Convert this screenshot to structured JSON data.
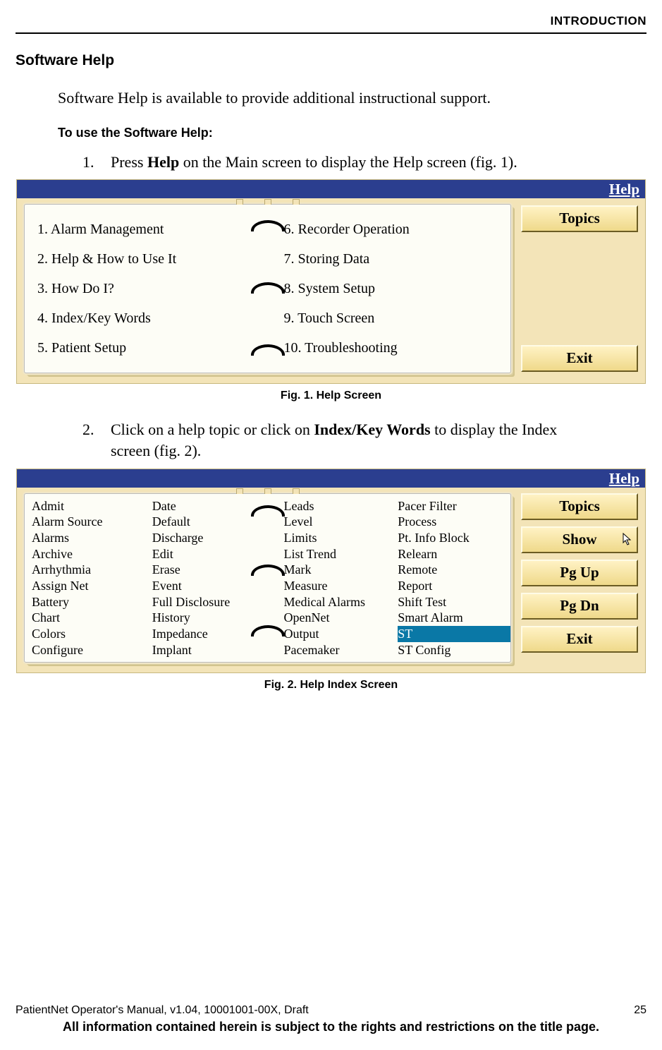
{
  "header": "INTRODUCTION",
  "h2": "Software Help",
  "intro": "Software Help is available to provide additional instructional support.",
  "use_h": "To use the Software Help:",
  "step1_num": "1.",
  "step1_a": "Press ",
  "step1_b": "Help",
  "step1_c": " on the Main screen to display the Help screen (fig. 1).",
  "step2_num": "2.",
  "step2_a": "Click on a help topic or click on ",
  "step2_b": "Index/Key Words",
  "step2_c": " to display the Index screen (fig. 2).",
  "fig1": {
    "title": "Help",
    "left": [
      {
        "n": "1.",
        "t": " Alarm Management"
      },
      {
        "n": "2.",
        "t": " Help & How to Use It"
      },
      {
        "n": "3.",
        "t": " How Do I?"
      },
      {
        "n": "4.",
        "t": " Index/Key Words"
      },
      {
        "n": "5.",
        "t": " Patient Setup"
      }
    ],
    "right": [
      {
        "n": "6.",
        "t": " Recorder Operation"
      },
      {
        "n": "7.",
        "t": " Storing Data"
      },
      {
        "n": "8.",
        "t": " System Setup"
      },
      {
        "n": "9.",
        "t": " Touch Screen"
      },
      {
        "n": "10.",
        "t": " Troubleshooting"
      }
    ],
    "btn_topics": "Topics",
    "btn_exit": "Exit",
    "caption": "Fig. 1. Help Screen"
  },
  "fig2": {
    "title": "Help",
    "colA": [
      "Admit",
      "Alarm Source",
      "Alarms",
      "Archive",
      "Arrhythmia",
      "Assign Net",
      "Battery",
      "Chart",
      "Colors",
      "Configure"
    ],
    "colB": [
      "Date",
      "Default",
      "Discharge",
      "Edit",
      "Erase",
      "Event",
      "Full Disclosure",
      "History",
      "Impedance",
      "Implant"
    ],
    "colC": [
      "Leads",
      "Level",
      "Limits",
      "List Trend",
      "Mark",
      "Measure",
      "Medical Alarms",
      "OpenNet",
      "Output",
      "Pacemaker"
    ],
    "colD": [
      "Pacer Filter",
      "Process",
      "Pt. Info Block",
      "Relearn",
      "Remote",
      "Report",
      "Shift Test",
      "Smart Alarm",
      "ST",
      "ST Config"
    ],
    "selected": "ST",
    "btn_topics": "Topics",
    "btn_show": "Show",
    "btn_pgup": "Pg Up",
    "btn_pgdn": "Pg Dn",
    "btn_exit": "Exit",
    "caption": "Fig. 2. Help Index Screen"
  },
  "footer": {
    "left": "PatientNet Operator's Manual, v1.04, 10001001-00X, Draft",
    "right": "25",
    "disclaimer": "All information contained herein is subject to the rights and restrictions on the title page."
  }
}
